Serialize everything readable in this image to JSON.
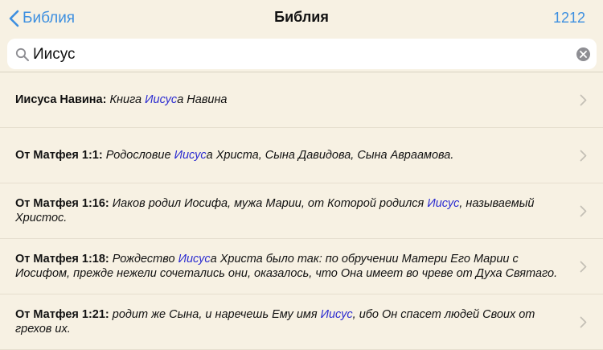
{
  "navbar": {
    "back_label": "Библия",
    "title": "Библия",
    "count": "1212"
  },
  "search": {
    "value": "Иисус",
    "placeholder": ""
  },
  "colors": {
    "accent": "#3d8fe0",
    "highlight": "#2a2ad0",
    "background": "#f7f1e3"
  },
  "icons": {
    "back": "chevron-left-icon",
    "search": "magnifier-icon",
    "clear": "clear-x-icon",
    "row": "chevron-right-icon"
  },
  "results": [
    {
      "ref": "Иисуса Навина:",
      "pre": "Книга ",
      "hl": "Иисус",
      "post": "а Навина"
    },
    {
      "ref": "От Матфея 1:1:",
      "pre": "Родословие ",
      "hl": "Иисус",
      "post": "а Христа, Сына Давидова, Сына Авраамова."
    },
    {
      "ref": "От Матфея 1:16:",
      "pre": "Иаков родил Иосифа, мужа Марии, от Которой родился ",
      "hl": "Иисус",
      "post": ", называемый Христос."
    },
    {
      "ref": "От Матфея 1:18:",
      "pre": "Рождество ",
      "hl": "Иисус",
      "post": "а Христа было так: по обручении Матери Его Марии с Иосифом, прежде нежели сочетались они, оказалось, что Она имеет во чреве от Духа Святаго."
    },
    {
      "ref": "От Матфея 1:21:",
      "pre": "родит же Сына, и наречешь Ему имя ",
      "hl": "Иисус",
      "post": ", ибо Он спасет людей Своих от грехов их."
    }
  ]
}
